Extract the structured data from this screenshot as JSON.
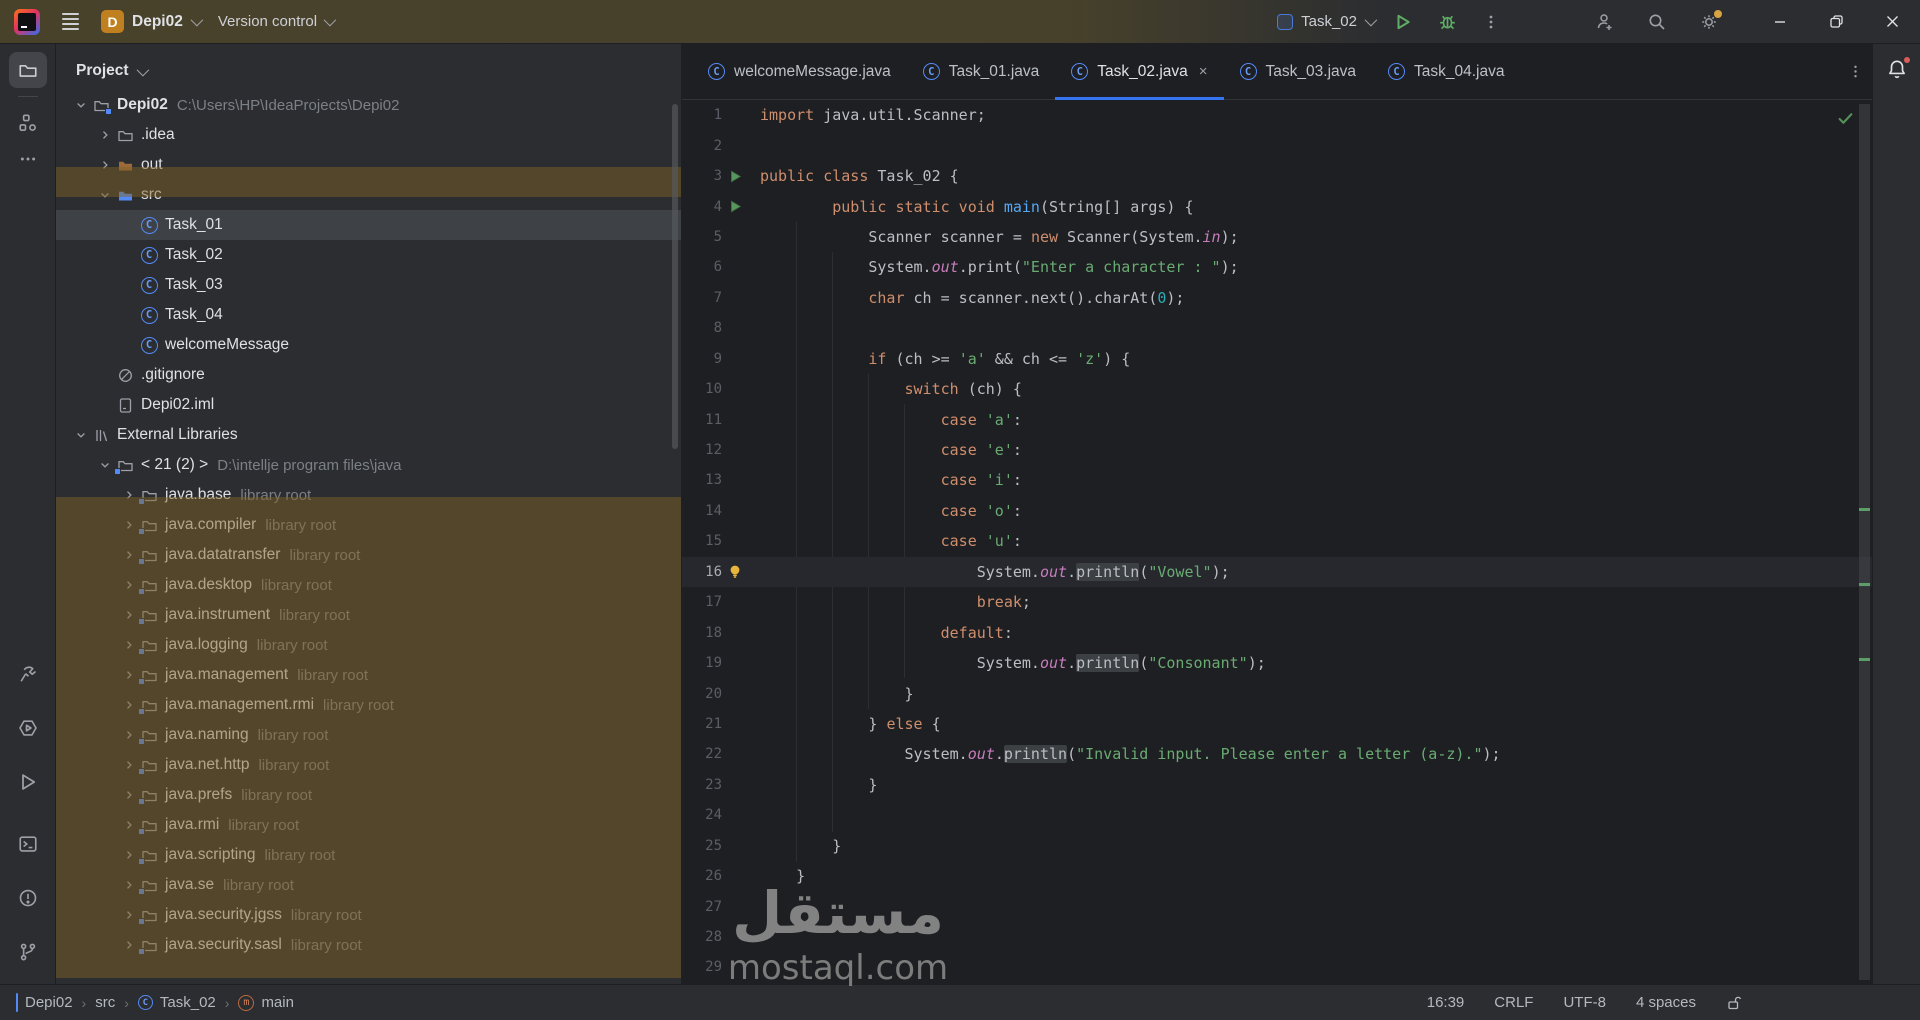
{
  "titlebar": {
    "project_badge": "D",
    "project_name": "Depi02",
    "menu_label": "Version control",
    "run_config": "Task_02"
  },
  "panel": {
    "header": "Project"
  },
  "tree": [
    {
      "depth": 0,
      "chev": "down",
      "icon": "projfolder",
      "label": "Depi02",
      "bold": true,
      "sub": "C:\\Users\\HP\\IdeaProjects\\Depi02"
    },
    {
      "depth": 1,
      "chev": "right",
      "icon": "folder",
      "label": ".idea"
    },
    {
      "depth": 1,
      "chev": "right",
      "icon": "folderout",
      "label": "out"
    },
    {
      "depth": 1,
      "chev": "down",
      "icon": "foldersrc",
      "label": "src"
    },
    {
      "depth": 2,
      "icon": "class",
      "label": "Task_01",
      "selected": true
    },
    {
      "depth": 2,
      "icon": "class",
      "label": "Task_02"
    },
    {
      "depth": 2,
      "icon": "class",
      "label": "Task_03"
    },
    {
      "depth": 2,
      "icon": "class",
      "label": "Task_04"
    },
    {
      "depth": 2,
      "icon": "class",
      "label": "welcomeMessage"
    },
    {
      "depth": 1,
      "icon": "ignored",
      "label": ".gitignore"
    },
    {
      "depth": 1,
      "icon": "file",
      "label": "Depi02.iml"
    },
    {
      "depth": 0,
      "chev": "down",
      "icon": "extlib",
      "label": "External Libraries"
    },
    {
      "depth": 1,
      "chev": "down",
      "icon": "jdk",
      "label": "< 21 (2) >",
      "sub": "D:\\intellje program files\\java"
    },
    {
      "depth": 2,
      "chev": "right",
      "icon": "libfolder",
      "label": "java.base",
      "sub": "library root"
    },
    {
      "depth": 2,
      "chev": "right",
      "icon": "libfolder",
      "label": "java.compiler",
      "sub": "library root"
    },
    {
      "depth": 2,
      "chev": "right",
      "icon": "libfolder",
      "label": "java.datatransfer",
      "sub": "library root"
    },
    {
      "depth": 2,
      "chev": "right",
      "icon": "libfolder",
      "label": "java.desktop",
      "sub": "library root"
    },
    {
      "depth": 2,
      "chev": "right",
      "icon": "libfolder",
      "label": "java.instrument",
      "sub": "library root"
    },
    {
      "depth": 2,
      "chev": "right",
      "icon": "libfolder",
      "label": "java.logging",
      "sub": "library root"
    },
    {
      "depth": 2,
      "chev": "right",
      "icon": "libfolder",
      "label": "java.management",
      "sub": "library root"
    },
    {
      "depth": 2,
      "chev": "right",
      "icon": "libfolder",
      "label": "java.management.rmi",
      "sub": "library root"
    },
    {
      "depth": 2,
      "chev": "right",
      "icon": "libfolder",
      "label": "java.naming",
      "sub": "library root"
    },
    {
      "depth": 2,
      "chev": "right",
      "icon": "libfolder",
      "label": "java.net.http",
      "sub": "library root"
    },
    {
      "depth": 2,
      "chev": "right",
      "icon": "libfolder",
      "label": "java.prefs",
      "sub": "library root"
    },
    {
      "depth": 2,
      "chev": "right",
      "icon": "libfolder",
      "label": "java.rmi",
      "sub": "library root"
    },
    {
      "depth": 2,
      "chev": "right",
      "icon": "libfolder",
      "label": "java.scripting",
      "sub": "library root"
    },
    {
      "depth": 2,
      "chev": "right",
      "icon": "libfolder",
      "label": "java.se",
      "sub": "library root"
    },
    {
      "depth": 2,
      "chev": "right",
      "icon": "libfolder",
      "label": "java.security.jgss",
      "sub": "library root"
    },
    {
      "depth": 2,
      "chev": "right",
      "icon": "libfolder",
      "label": "java.security.sasl",
      "sub": "library root"
    }
  ],
  "tabs": {
    "items": [
      "welcomeMessage.java",
      "Task_01.java",
      "Task_02.java",
      "Task_03.java",
      "Task_04.java"
    ],
    "active_index": 2,
    "close_glyph": "×"
  },
  "code": {
    "run_lines": [
      3,
      4
    ],
    "current_line": 16,
    "bulb_line": 16,
    "lines": [
      {
        "n": 1,
        "t": [
          [
            "k",
            "import"
          ],
          [
            "p",
            " java.util.Scanner;"
          ]
        ]
      },
      {
        "n": 2,
        "t": []
      },
      {
        "n": 3,
        "t": [
          [
            "k",
            "public class"
          ],
          [
            "p",
            " Task_02 {"
          ]
        ]
      },
      {
        "n": 4,
        "t": [
          [
            "p",
            "        "
          ],
          [
            "k",
            "public static void"
          ],
          [
            "p",
            " "
          ],
          [
            "m",
            "main"
          ],
          [
            "p",
            "(String[] args) {"
          ]
        ]
      },
      {
        "n": 5,
        "t": [
          [
            "p",
            "            Scanner scanner = "
          ],
          [
            "k",
            "new"
          ],
          [
            "p",
            " Scanner(System."
          ],
          [
            "f",
            "in"
          ],
          [
            "p",
            ");"
          ]
        ]
      },
      {
        "n": 6,
        "t": [
          [
            "p",
            "            System."
          ],
          [
            "f",
            "out"
          ],
          [
            "p",
            ".print("
          ],
          [
            "s",
            "\"Enter a character : \""
          ],
          [
            "p",
            ");"
          ]
        ]
      },
      {
        "n": 7,
        "t": [
          [
            "p",
            "            "
          ],
          [
            "k",
            "char"
          ],
          [
            "p",
            " ch = scanner.next().charAt("
          ],
          [
            "n2",
            "0"
          ],
          [
            "p",
            ");"
          ]
        ]
      },
      {
        "n": 8,
        "t": []
      },
      {
        "n": 9,
        "t": [
          [
            "p",
            "            "
          ],
          [
            "k",
            "if"
          ],
          [
            "p",
            " (ch >= "
          ],
          [
            "s",
            "'a'"
          ],
          [
            "p",
            " && ch <= "
          ],
          [
            "s",
            "'z'"
          ],
          [
            "p",
            ") {"
          ]
        ]
      },
      {
        "n": 10,
        "t": [
          [
            "p",
            "                "
          ],
          [
            "k",
            "switch"
          ],
          [
            "p",
            " (ch) {"
          ]
        ]
      },
      {
        "n": 11,
        "t": [
          [
            "p",
            "                    "
          ],
          [
            "k",
            "case"
          ],
          [
            "p",
            " "
          ],
          [
            "s",
            "'a'"
          ],
          [
            "p",
            ":"
          ]
        ]
      },
      {
        "n": 12,
        "t": [
          [
            "p",
            "                    "
          ],
          [
            "k",
            "case"
          ],
          [
            "p",
            " "
          ],
          [
            "s",
            "'e'"
          ],
          [
            "p",
            ":"
          ]
        ]
      },
      {
        "n": 13,
        "t": [
          [
            "p",
            "                    "
          ],
          [
            "k",
            "case"
          ],
          [
            "p",
            " "
          ],
          [
            "s",
            "'i'"
          ],
          [
            "p",
            ":"
          ]
        ]
      },
      {
        "n": 14,
        "t": [
          [
            "p",
            "                    "
          ],
          [
            "k",
            "case"
          ],
          [
            "p",
            " "
          ],
          [
            "s",
            "'o'"
          ],
          [
            "p",
            ":"
          ]
        ]
      },
      {
        "n": 15,
        "t": [
          [
            "p",
            "                    "
          ],
          [
            "k",
            "case"
          ],
          [
            "p",
            " "
          ],
          [
            "s",
            "'u'"
          ],
          [
            "p",
            ":"
          ]
        ]
      },
      {
        "n": 16,
        "t": [
          [
            "p",
            "                        System."
          ],
          [
            "f",
            "out"
          ],
          [
            "p",
            "."
          ],
          [
            "u",
            "println"
          ],
          [
            "p",
            "("
          ],
          [
            "s",
            "\"Vowel\""
          ],
          [
            "p",
            ");"
          ]
        ]
      },
      {
        "n": 17,
        "t": [
          [
            "p",
            "                        "
          ],
          [
            "k",
            "break"
          ],
          [
            "p",
            ";"
          ]
        ]
      },
      {
        "n": 18,
        "t": [
          [
            "p",
            "                    "
          ],
          [
            "k",
            "default"
          ],
          [
            "p",
            ":"
          ]
        ]
      },
      {
        "n": 19,
        "t": [
          [
            "p",
            "                        System."
          ],
          [
            "f",
            "out"
          ],
          [
            "p",
            "."
          ],
          [
            "u",
            "println"
          ],
          [
            "p",
            "("
          ],
          [
            "s",
            "\"Consonant\""
          ],
          [
            "p",
            ");"
          ]
        ]
      },
      {
        "n": 20,
        "t": [
          [
            "p",
            "                }"
          ]
        ]
      },
      {
        "n": 21,
        "t": [
          [
            "p",
            "            } "
          ],
          [
            "k",
            "else"
          ],
          [
            "p",
            " {"
          ]
        ]
      },
      {
        "n": 22,
        "t": [
          [
            "p",
            "                System."
          ],
          [
            "f",
            "out"
          ],
          [
            "p",
            "."
          ],
          [
            "u",
            "println"
          ],
          [
            "p",
            "("
          ],
          [
            "s",
            "\"Invalid input. Please enter a letter (a-z).\""
          ],
          [
            "p",
            ");"
          ]
        ]
      },
      {
        "n": 23,
        "t": [
          [
            "p",
            "            }"
          ]
        ]
      },
      {
        "n": 24,
        "t": []
      },
      {
        "n": 25,
        "t": [
          [
            "p",
            "        }"
          ]
        ]
      },
      {
        "n": 26,
        "t": [
          [
            "p",
            "    }"
          ]
        ]
      },
      {
        "n": 27,
        "t": []
      },
      {
        "n": 28,
        "t": []
      },
      {
        "n": 29,
        "t": []
      }
    ]
  },
  "statusbar": {
    "breadcrumbs": [
      "Depi02",
      "src",
      "Task_02",
      "main"
    ],
    "caret_position": "16:39",
    "line_separator": "CRLF",
    "encoding": "UTF-8",
    "indent": "4 spaces"
  },
  "watermark": {
    "arabic": "مستقل",
    "latin": "mostaql.com"
  },
  "colors": {
    "accent_blue": "#3574f0",
    "run_green": "#5fad65",
    "keyword": "#cf8e6d",
    "string": "#6aab73",
    "number": "#2aacb8",
    "method": "#56a8f5",
    "field": "#c77dbb",
    "watermark_brown": "#7a5e24",
    "notification_red": "#db5c5c",
    "settings_dot": "#d9a343"
  }
}
